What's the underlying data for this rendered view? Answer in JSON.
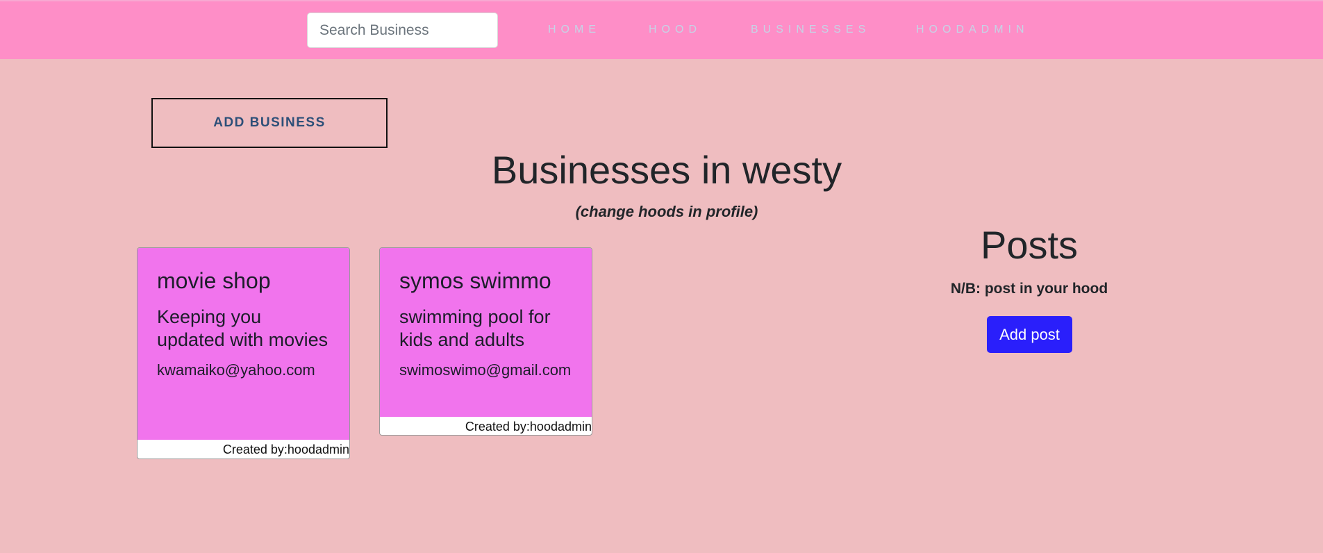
{
  "navbar": {
    "search_placeholder": "Search Business",
    "links": {
      "home": "HOME",
      "hood": "HOOD",
      "businesses": "BUSINESSES",
      "hoodadmin": "HOODADMIN"
    }
  },
  "main": {
    "add_business_label": "ADD BUSINESS",
    "title": "Businesses in westy",
    "subtitle": "(change hoods in profile)",
    "businesses": [
      {
        "name": "movie shop",
        "description": "Keeping you updated with movies",
        "email": "kwamaiko@yahoo.com",
        "created_by": "Created by:hoodadmin"
      },
      {
        "name": "symos swimmo",
        "description": "swimming pool for kids and adults",
        "email": "swimoswimo@gmail.com",
        "created_by": "Created by:hoodadmin"
      }
    ]
  },
  "posts": {
    "title": "Posts",
    "note": "N/B: post in your hood",
    "add_post_label": "Add post"
  },
  "colors": {
    "page_background": "#efbdc0",
    "navbar_background": "#fe8ec7",
    "card_background": "#f174ed",
    "add_post_button": "#2a1ffb",
    "nav_link": "#c6d3e6"
  }
}
